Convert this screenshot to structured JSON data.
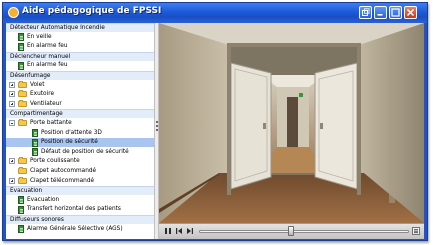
{
  "window": {
    "title": "Aide pédagogique de FPSSI",
    "accent": "#2452c4"
  },
  "tree": [
    {
      "label": "Détecteur Automatique Incendie",
      "kind": "group"
    },
    {
      "label": "En veille",
      "kind": "doc"
    },
    {
      "label": "En alarme feu",
      "kind": "doc"
    },
    {
      "label": "Déclencheur manuel",
      "kind": "group"
    },
    {
      "label": "En alarme feu",
      "kind": "doc"
    },
    {
      "label": "Désenfumage",
      "kind": "group"
    },
    {
      "label": "Volet",
      "kind": "folder"
    },
    {
      "label": "Exutoire",
      "kind": "folder"
    },
    {
      "label": "Ventilateur",
      "kind": "folder"
    },
    {
      "label": "Compartimentage",
      "kind": "group"
    },
    {
      "label": "Porte battante",
      "kind": "folder-open"
    },
    {
      "label": "Position d'attente 3D",
      "kind": "doc2"
    },
    {
      "label": "Position de sécurité",
      "kind": "doc2",
      "selected": true
    },
    {
      "label": "Défaut de position de sécurité",
      "kind": "doc2"
    },
    {
      "label": "Porte coulissante",
      "kind": "folder"
    },
    {
      "label": "Clapet autocommandé",
      "kind": "folder-plain"
    },
    {
      "label": "Clapet télécommandé",
      "kind": "folder"
    },
    {
      "label": "Evacuation",
      "kind": "group"
    },
    {
      "label": "Evacuation",
      "kind": "doc"
    },
    {
      "label": "Transfert horizontal des patients",
      "kind": "doc"
    },
    {
      "label": "Diffuseurs sonores",
      "kind": "group"
    },
    {
      "label": "Alarme Générale Sélective (AGS)",
      "kind": "doc"
    }
  ],
  "player": {
    "progress": 0.44,
    "controls": [
      "play-icon",
      "previous-frame-icon",
      "next-frame-icon",
      "menu-icon"
    ]
  }
}
